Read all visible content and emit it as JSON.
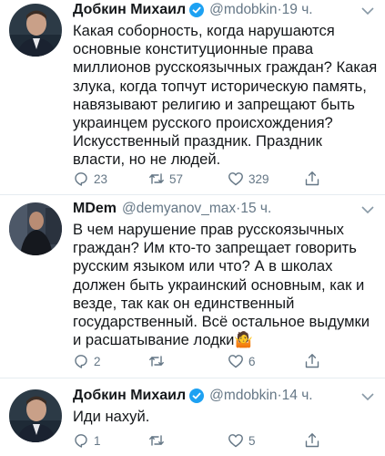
{
  "tweets": [
    {
      "author_name": "Добкин Михаил",
      "handle": "@mdobkin",
      "separator": "·",
      "time": "19 ч.",
      "verified": true,
      "text_lines": [
        "Какая соборность, когда нарушаются",
        "основные конституционные права",
        "миллионов русскоязычных граждан? Какая",
        "злука, когда топчут историческую память,",
        "навязывают религию и запрещают быть",
        "украинцем русского происхождения?",
        "Искусственный праздник. Праздник",
        "власти, но не людей."
      ],
      "replies": "23",
      "retweets": "57",
      "likes": "329"
    },
    {
      "author_name": "MDem",
      "handle": "@demyanov_max",
      "separator": "·",
      "time": "15 ч.",
      "verified": false,
      "text_lines": [
        "В чем нарушение прав русскоязычных",
        "граждан? Им кто-то запрещает говорить",
        "русским языком или что? А в школах",
        "должен быть украинский основным, как и",
        "везде, так как он единственный",
        "государственный. Всё остальное выдумки",
        "и расшатывание лодки"
      ],
      "emoji": "🤷",
      "replies": "2",
      "retweets": "",
      "likes": "6"
    },
    {
      "author_name": "Добкин Михаил",
      "handle": "@mdobkin",
      "separator": "·",
      "time": "14 ч.",
      "verified": true,
      "text_lines": [
        "Иди нахуй."
      ],
      "replies": "1",
      "retweets": "",
      "likes": "5"
    }
  ],
  "colors": {
    "text": "#14171a",
    "secondary": "#657786",
    "verified": "#1da1f2",
    "divider": "#e6ecf0"
  },
  "icons": {
    "reply": "reply-icon",
    "retweet": "retweet-icon",
    "like": "heart-icon",
    "share": "share-icon",
    "menu": "chevron-down-icon",
    "verified": "verified-badge-icon"
  }
}
